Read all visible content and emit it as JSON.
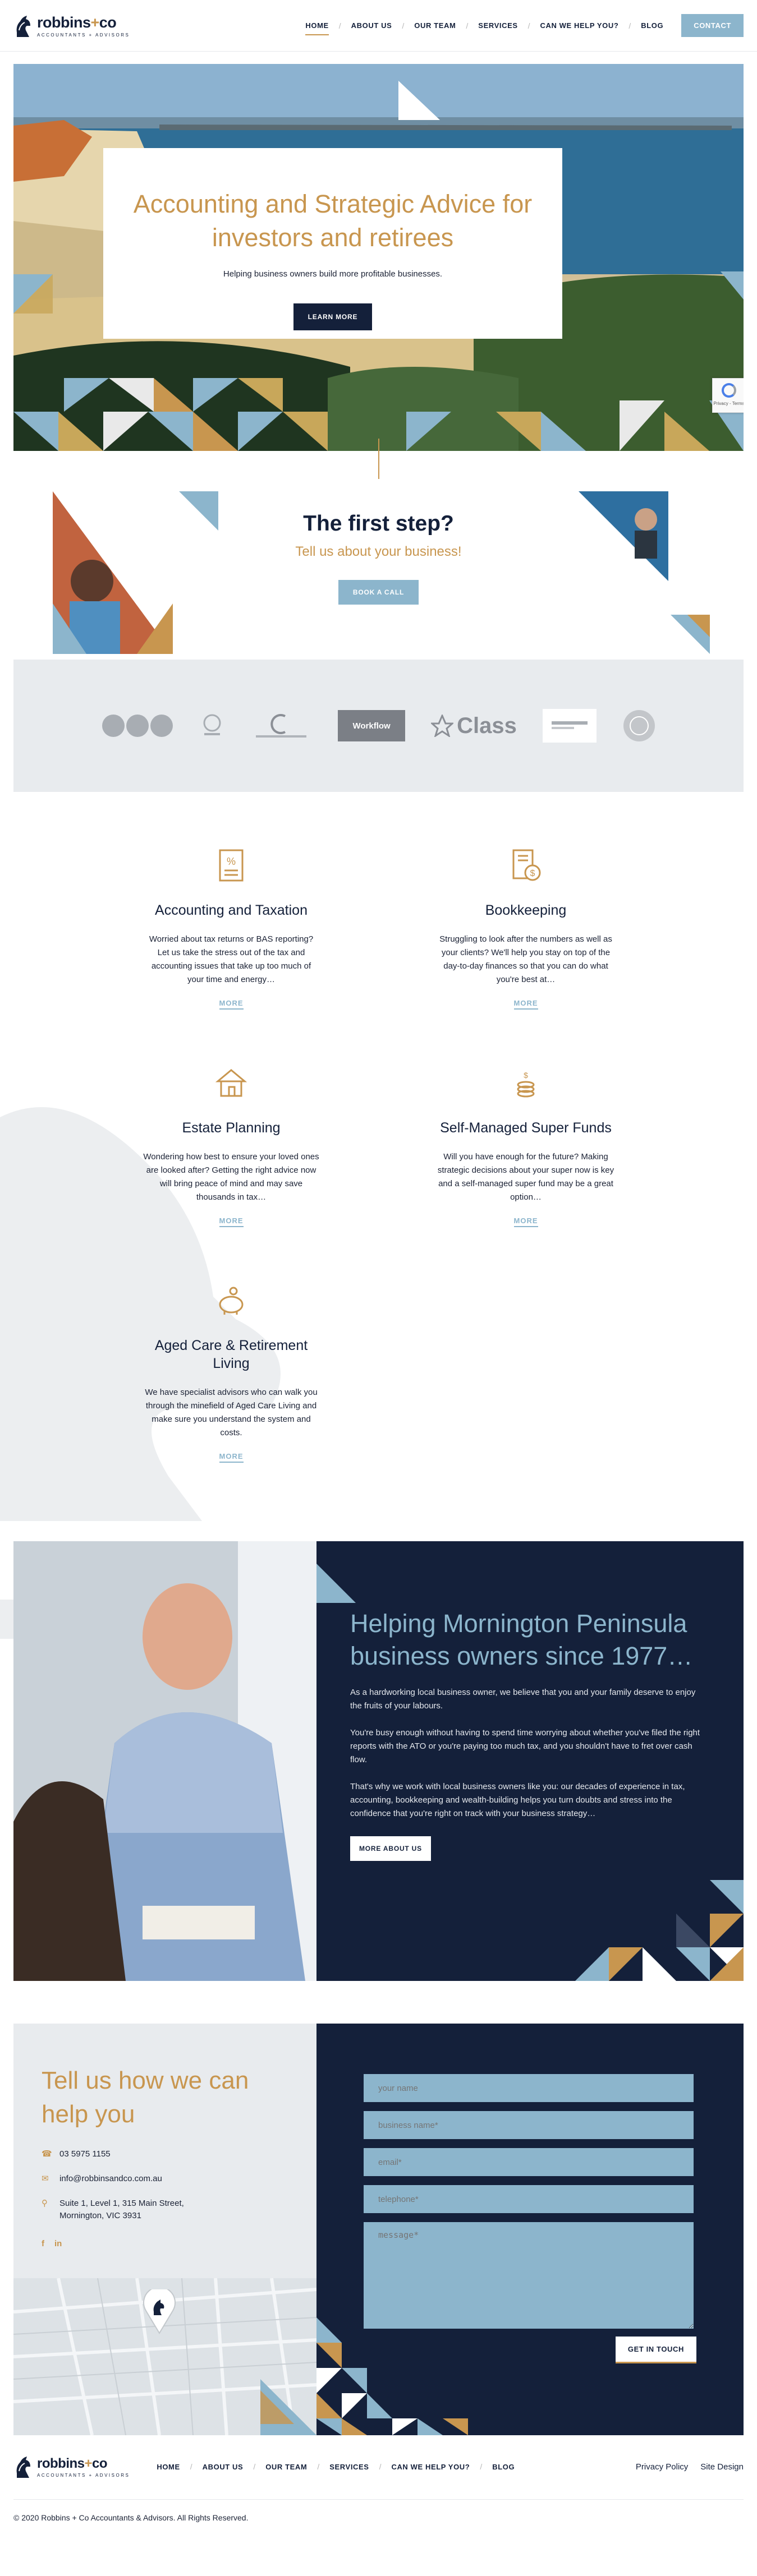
{
  "brand": {
    "name_left": "robbins",
    "name_plus": "+",
    "name_right": "co",
    "tagline": "ACCOUNTANTS + ADVISORS"
  },
  "nav": {
    "items": [
      {
        "label": "HOME",
        "active": true
      },
      {
        "label": "ABOUT US"
      },
      {
        "label": "OUR TEAM"
      },
      {
        "label": "SERVICES"
      },
      {
        "label": "CAN WE HELP YOU?"
      },
      {
        "label": "BLOG"
      }
    ],
    "contact_label": "CONTACT",
    "separator": "/"
  },
  "hero": {
    "title": "Accounting and Strategic Advice for investors and retirees",
    "subtitle": "Helping business owners build more profitable businesses.",
    "button": "LEARN MORE"
  },
  "recaptcha": {
    "text": "Privacy - Terms"
  },
  "first_step": {
    "title": "The first step?",
    "subtitle": "Tell us about your business!",
    "button": "BOOK A CALL"
  },
  "partners": {
    "class_label": "Class",
    "workflowmax_label": "Workflow"
  },
  "services": [
    {
      "icon": "document-percent-icon",
      "title": "Accounting and Taxation",
      "text": "Worried about tax returns or BAS reporting? Let us take the stress out of the tax and accounting issues that take up too much of your time and energy…",
      "more": "MORE"
    },
    {
      "icon": "ledger-dollar-icon",
      "title": "Bookkeeping",
      "text": "Struggling to look after the numbers as well as your clients? We'll help you stay on top of the day-to-day finances so that you can do what you're best at…",
      "more": "MORE"
    },
    {
      "icon": "house-icon",
      "title": "Estate Planning",
      "text": "Wondering how best to ensure your loved ones are looked after? Getting the right advice now will bring peace of mind and may save thousands in tax…",
      "more": "MORE"
    },
    {
      "icon": "coins-icon",
      "title": "Self-Managed Super Funds",
      "text": "Will you have enough for the future? Making strategic decisions about your super now is key and a self-managed super fund may be a great option…",
      "more": "MORE"
    },
    {
      "icon": "piggy-bank-icon",
      "title": "Aged Care & Retirement Living",
      "text": "We have specialist advisors who can walk you through the minefield of Aged Care Living and make sure you understand the system and costs.",
      "more": "MORE"
    }
  ],
  "about": {
    "title": "Helping Mornington Peninsula business owners since 1977…",
    "paragraphs": [
      "As a hardworking local business owner, we believe that you and your family deserve to enjoy the fruits of your labours.",
      "You're busy enough without having to spend time worrying about whether you've filed the right reports with the ATO or you're paying too much tax, and you shouldn't have to fret over cash flow.",
      "That's why we work with local business owners like you: our decades of experience in tax, accounting, bookkeeping and wealth-building helps you turn doubts and stress into the confidence that you're right on track with your business strategy…"
    ],
    "button": "MORE ABOUT US"
  },
  "contact": {
    "title": "Tell us how we can help you",
    "phone": "03 5975 1155",
    "email": "info@robbinsandco.com.au",
    "address_line1": "Suite 1, Level 1, 315 Main Street,",
    "address_line2": "Mornington, VIC 3931",
    "social_facebook": "f",
    "social_linkedin": "in",
    "form": {
      "name_placeholder": "your name",
      "business_placeholder": "business name*",
      "email_placeholder": "email*",
      "phone_placeholder": "telephone*",
      "message_placeholder": "message*",
      "submit": "GET IN TOUCH"
    }
  },
  "footer": {
    "nav": [
      "HOME",
      "ABOUT US",
      "OUR TEAM",
      "SERVICES",
      "CAN WE HELP YOU?",
      "BLOG"
    ],
    "privacy": "Privacy Policy",
    "site_design": "Site Design",
    "copyright": "© 2020 Robbins + Co Accountants & Advisors. All Rights Reserved."
  },
  "colors": {
    "navy": "#14203a",
    "gold": "#c8964f",
    "light_blue": "#8cb5cc",
    "light_grey": "#e8ebee"
  }
}
